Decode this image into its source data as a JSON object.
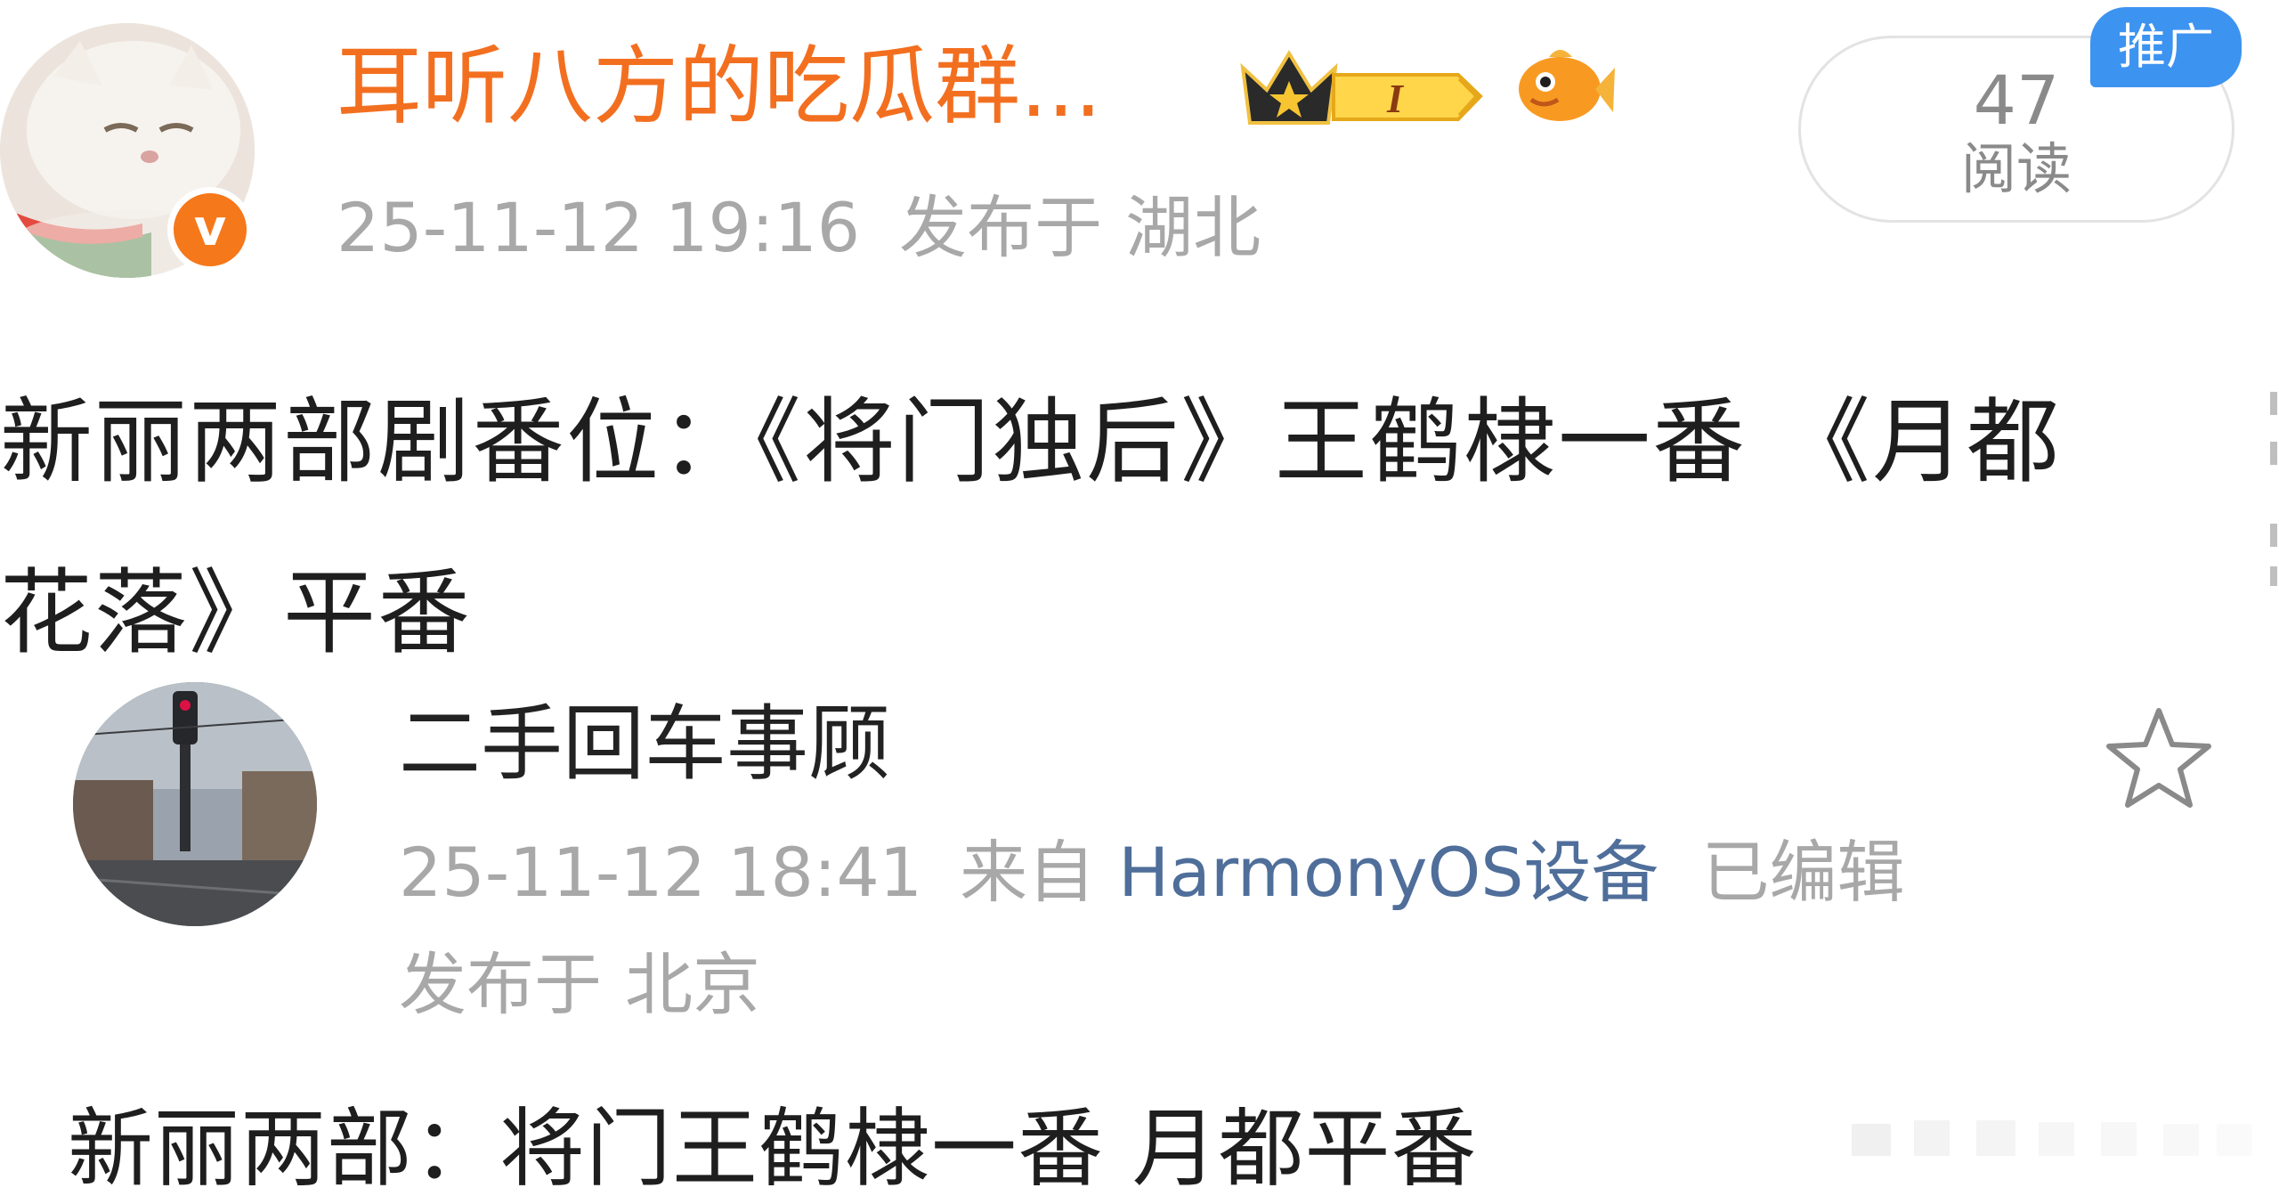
{
  "post": {
    "username": "耳听八方的吃瓜群...",
    "timestamp": "25-11-12 19:16",
    "location_prefix": "发布于",
    "location": "湖北",
    "read_count": "47",
    "read_label": "阅读",
    "promo_badge": "推广",
    "level_badge": "I",
    "verified_mark": "v",
    "body_line1": "新丽两部剧番位：《将门独后》王鹤棣一番 《月都",
    "body_line2": "花落》平番"
  },
  "quoted": {
    "username": "二手回车事顾",
    "timestamp": "25-11-12 18:41",
    "source_prefix": "来自",
    "device": "HarmonyOS设备",
    "edited": "已编辑",
    "location_prefix": "发布于",
    "location": "北京",
    "body": "新丽两部：将门王鹤棣一番 月都平番"
  },
  "colors": {
    "username": "#f36f20",
    "meta": "#a8a8a8",
    "link": "#4f6e9a",
    "promo": "#3d93f0",
    "verified": "#f5781b"
  },
  "icons": [
    "crown-badge-icon",
    "fish-badge-icon",
    "verified-icon",
    "star-icon"
  ]
}
